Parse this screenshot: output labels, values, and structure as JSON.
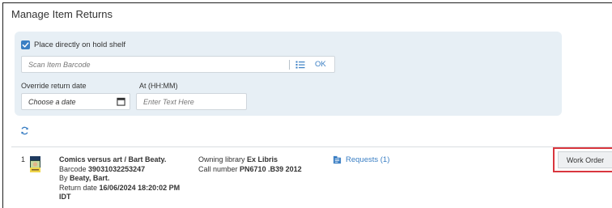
{
  "page": {
    "title": "Manage Item Returns"
  },
  "form": {
    "hold_shelf_label": "Place directly on hold shelf",
    "hold_shelf_checked": true,
    "barcode_placeholder": "Scan Item Barcode",
    "ok_label": "OK",
    "override_label": "Override return date",
    "date_placeholder": "Choose a date",
    "time_label": "At (HH:MM)",
    "time_placeholder": "Enter Text Here"
  },
  "icons": {
    "list": "list-icon",
    "calendar": "calendar-icon",
    "refresh": "refresh-icon",
    "requests": "requests-icon",
    "check": "check-icon"
  },
  "colors": {
    "accent": "#3b7fc4",
    "panel": "#e7eff5",
    "highlight": "#d9363e"
  },
  "items": [
    {
      "index": "1",
      "title": "Comics versus art / Bart Beaty.",
      "barcode_label": "Barcode",
      "barcode": "39031032253247",
      "by_label": "By",
      "author": "Beaty, Bart.",
      "return_label": "Return date",
      "return_date": "16/06/2024 18:20:02 PM",
      "timezone": "IDT",
      "owning_label": "Owning library",
      "owning_library": "Ex Libris",
      "call_label": "Call number",
      "call_number": "PN6710 .B39 2012",
      "requests": "Requests (1)",
      "action": "Work Order"
    }
  ]
}
